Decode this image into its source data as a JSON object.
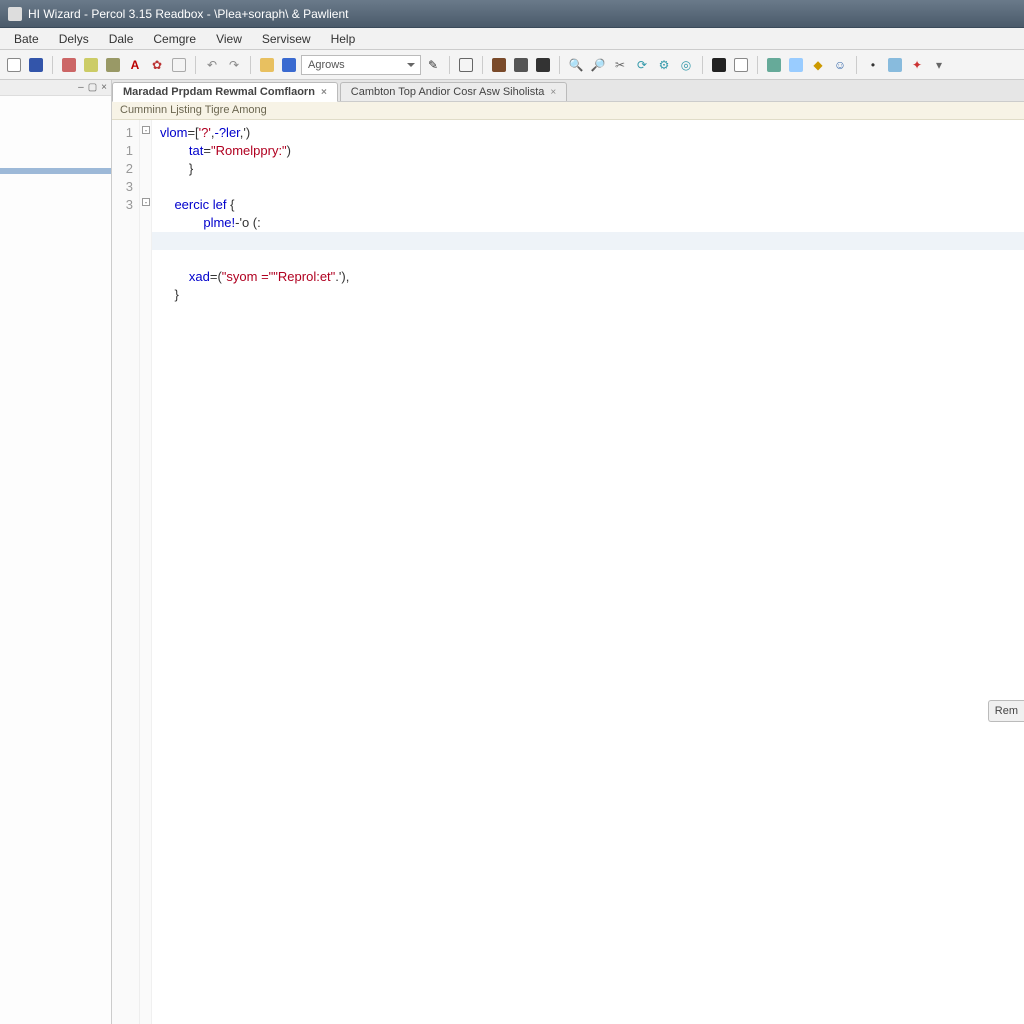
{
  "window": {
    "title": "HI Wizard - Percol 3.15 Readbox - \\Plea+soraph\\ & Pawlient"
  },
  "menu": {
    "items": [
      "Bate",
      "Delys",
      "Dale",
      "Cemgre",
      "View",
      "Servisew",
      "Help"
    ]
  },
  "toolbar": {
    "combo_value": "Agrows",
    "icons": {
      "new": "new-file-icon",
      "save": "save-icon",
      "cut": "cut-icon",
      "copy": "copy-icon",
      "paste": "paste-icon",
      "undo": "undo-icon",
      "redo": "redo-icon",
      "search": "search-icon",
      "run": "run-icon",
      "stop": "stop-icon",
      "build": "build-icon",
      "folder": "folder-icon",
      "box": "box-icon",
      "wrench": "wrench-icon",
      "zoom": "zoom-icon",
      "home": "home-icon",
      "mail": "mail-icon",
      "gear": "gear-icon"
    }
  },
  "sidebar": {
    "header_glyphs": [
      "–",
      "▢",
      "×"
    ],
    "items": [
      {
        "label": ""
      },
      {
        "label": ""
      },
      {
        "label": "",
        "selected": true
      },
      {
        "label": ""
      },
      {
        "label": ""
      }
    ]
  },
  "editor": {
    "tabs": [
      {
        "label": "Maradad Prpdam Rewmal Comflaorn",
        "active": true,
        "closable": true
      },
      {
        "label": "Cambton Top  Andior  Cosr  Asw  Siholista",
        "active": false,
        "closable": true
      }
    ],
    "breadcrumb": "Cumminn Ljsting Tigre Among",
    "gutter": [
      "1",
      "",
      "",
      "",
      "1",
      "2",
      "3",
      "",
      "3",
      ""
    ],
    "code_lines": [
      {
        "tokens": [
          {
            "t": "vlom",
            "c": "kw"
          },
          {
            "t": "=",
            "c": "br"
          },
          {
            "t": "[",
            "c": "br"
          },
          {
            "t": "'?'",
            "c": "str"
          },
          {
            "t": ",",
            "c": "br"
          },
          {
            "t": "-?ler",
            "c": "kw"
          },
          {
            "t": ",",
            "c": "br"
          },
          {
            "t": "')",
            "c": "br"
          }
        ],
        "indent": 0
      },
      {
        "tokens": [
          {
            "t": "tat",
            "c": "kw"
          },
          {
            "t": "=",
            "c": "br"
          },
          {
            "t": "\"Romelppry:\"",
            "c": "str"
          },
          {
            "t": ")",
            "c": "br"
          }
        ],
        "indent": 2
      },
      {
        "tokens": [
          {
            "t": "}",
            "c": "br"
          }
        ],
        "indent": 2
      },
      {
        "tokens": [],
        "indent": 0
      },
      {
        "tokens": [
          {
            "t": "eercic lef",
            "c": "kw"
          },
          {
            "t": " {",
            "c": "br"
          }
        ],
        "indent": 1
      },
      {
        "tokens": [
          {
            "t": "plme!",
            "c": "kw"
          },
          {
            "t": "-'o (:",
            "c": "br"
          }
        ],
        "indent": 3
      },
      {
        "tokens": [],
        "indent": 0,
        "highlight": true
      },
      {
        "tokens": [],
        "indent": 0
      },
      {
        "tokens": [
          {
            "t": "xad",
            "c": "kw"
          },
          {
            "t": "=(",
            "c": "br"
          },
          {
            "t": "\"syom =\"",
            "c": "str"
          },
          {
            "t": "\"Reprol:et\"",
            "c": "str"
          },
          {
            "t": ".'),",
            "c": "br"
          }
        ],
        "indent": 2
      },
      {
        "tokens": [
          {
            "t": "}",
            "c": "br"
          }
        ],
        "indent": 1
      }
    ],
    "side_button": "Rem"
  }
}
